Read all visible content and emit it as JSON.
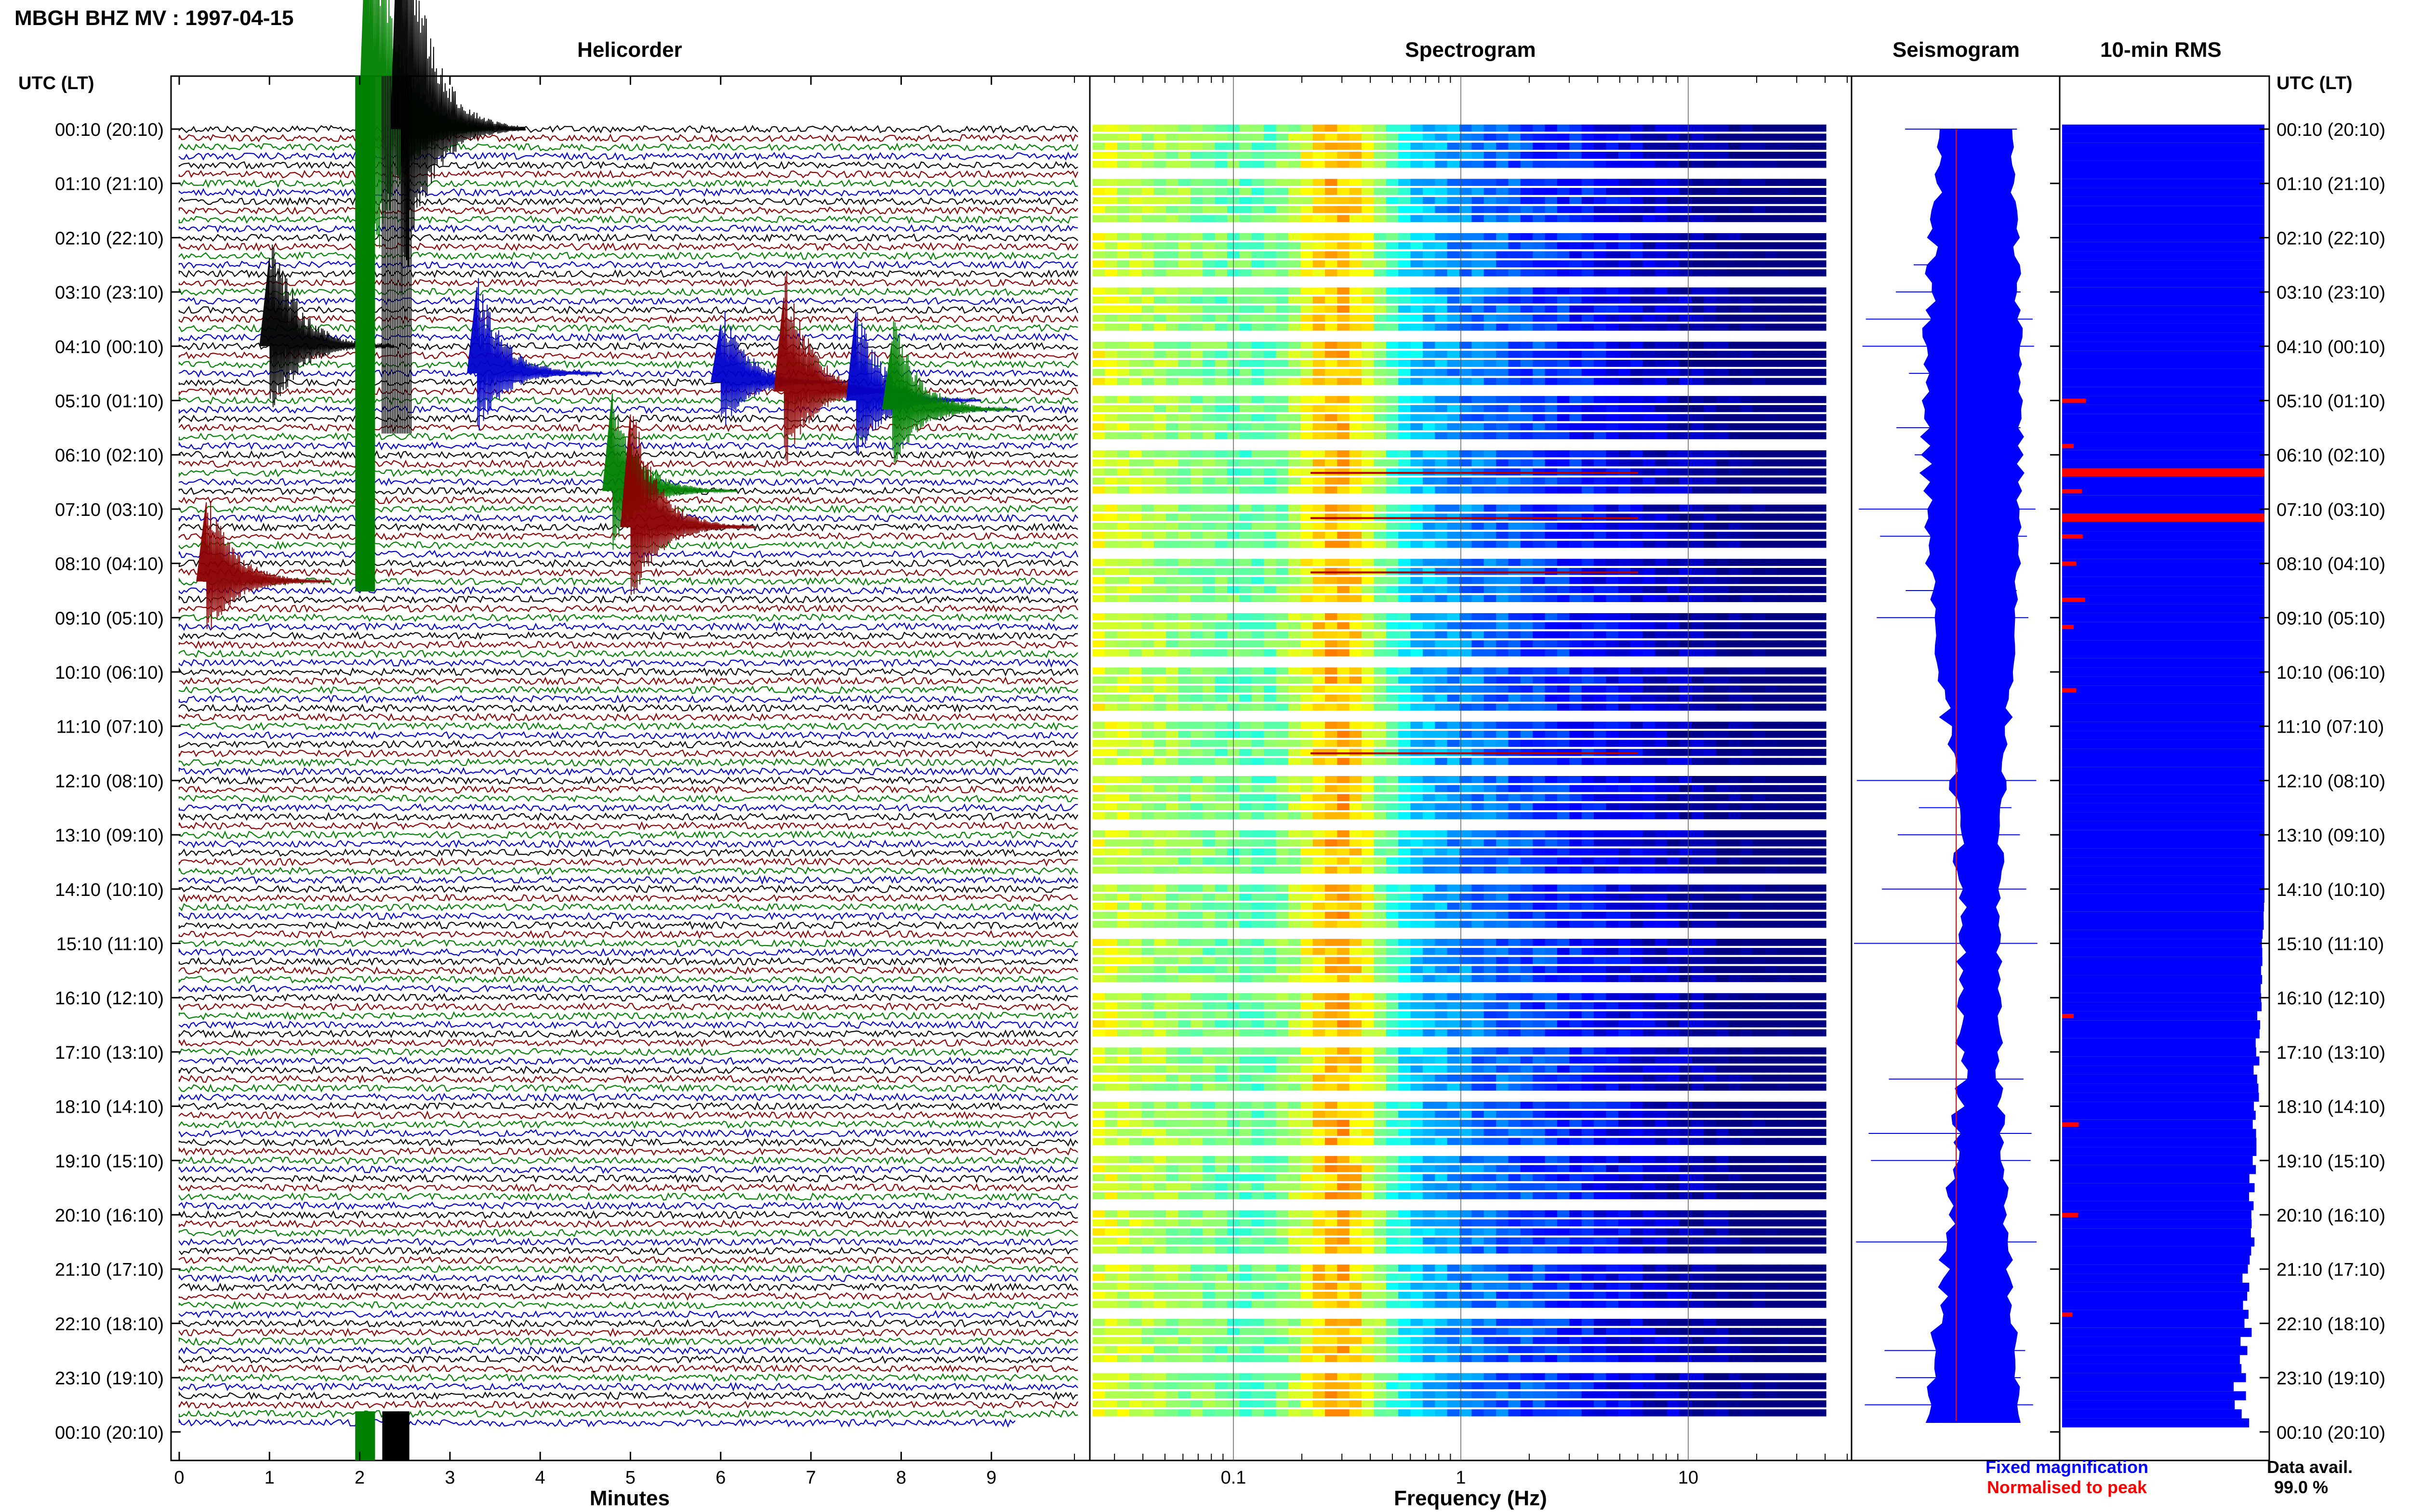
{
  "page_title": "MBGH BHZ MV : 1997-04-15",
  "panels": {
    "helicorder": "Helicorder",
    "spectrogram": "Spectrogram",
    "seismogram": "Seismogram",
    "rms": "10-min RMS"
  },
  "time_axis_header": "UTC (LT)",
  "time_labels": [
    "00:10 (20:10)",
    "01:10 (21:10)",
    "02:10 (22:10)",
    "03:10 (23:10)",
    "04:10 (00:10)",
    "05:10 (01:10)",
    "06:10 (02:10)",
    "07:10 (03:10)",
    "08:10 (04:10)",
    "09:10 (05:10)",
    "10:10 (06:10)",
    "11:10 (07:10)",
    "12:10 (08:10)",
    "13:10 (09:10)",
    "14:10 (10:10)",
    "15:10 (11:10)",
    "16:10 (12:10)",
    "17:10 (13:10)",
    "18:10 (14:10)",
    "19:10 (15:10)",
    "20:10 (16:10)",
    "21:10 (17:10)",
    "22:10 (18:10)",
    "23:10 (19:10)",
    "00:10 (20:10)"
  ],
  "legend": {
    "fixed": "Fixed magnification",
    "normalised": "Normalised to peak"
  },
  "data_availability": {
    "label": "Data avail.",
    "value": "99.0 %"
  },
  "colors": {
    "trace_cycle": [
      "#000000",
      "#8b0000",
      "#008000",
      "#0000cd"
    ],
    "seismo_fixed": "#0000ff",
    "seismo_normalised": "#ff0000",
    "rms_fill": "#0000ff",
    "rms_spike": "#ff0000"
  },
  "chart_data": [
    {
      "type": "line",
      "name": "helicorder",
      "title": "Helicorder",
      "xlabel": "Minutes",
      "xlim": [
        0,
        10
      ],
      "x_ticks": [
        0,
        1,
        2,
        3,
        4,
        5,
        6,
        7,
        8,
        9
      ],
      "rows_per_hour": 6,
      "row_minutes": 10,
      "events": [
        {
          "row": 0,
          "minute": 2.1,
          "amp": 9,
          "color": 2
        },
        {
          "row": 0,
          "minute": 2.45,
          "amp": 9,
          "color": 0
        },
        {
          "row": 24,
          "minute": 1.0,
          "amp": 4,
          "color": 0
        },
        {
          "row": 27,
          "minute": 3.3,
          "amp": 3,
          "color": 3
        },
        {
          "row": 28,
          "minute": 6.0,
          "amp": 2.5,
          "color": 3
        },
        {
          "row": 29,
          "minute": 6.7,
          "amp": 4,
          "color": 1
        },
        {
          "row": 30,
          "minute": 7.5,
          "amp": 3,
          "color": 3
        },
        {
          "row": 31,
          "minute": 7.9,
          "amp": 3,
          "color": 2
        },
        {
          "row": 40,
          "minute": 4.8,
          "amp": 3,
          "color": 2
        },
        {
          "row": 44,
          "minute": 5.0,
          "amp": 4,
          "color": 1
        },
        {
          "row": 50,
          "minute": 0.3,
          "amp": 3,
          "color": 1
        }
      ]
    },
    {
      "type": "heatmap",
      "name": "spectrogram",
      "title": "Spectrogram",
      "xlabel": "Frequency (Hz)",
      "x_scale": "log",
      "xlim": [
        0.02,
        50
      ],
      "x_tick_labels": [
        "0.1",
        "1",
        "10"
      ],
      "x_ticks": [
        0.1,
        1,
        10
      ],
      "peak_band_hz": [
        0.2,
        0.5
      ],
      "colormap": "jet"
    },
    {
      "type": "line",
      "name": "seismogram",
      "title": "Seismogram",
      "series": [
        {
          "name": "Fixed magnification",
          "color": "#0000ff"
        },
        {
          "name": "Normalised to peak",
          "color": "#ff0000"
        }
      ]
    },
    {
      "type": "bar",
      "name": "rms",
      "title": "10-min RMS",
      "orientation": "horizontal",
      "spikes_at_rows": [
        38,
        43
      ]
    }
  ]
}
